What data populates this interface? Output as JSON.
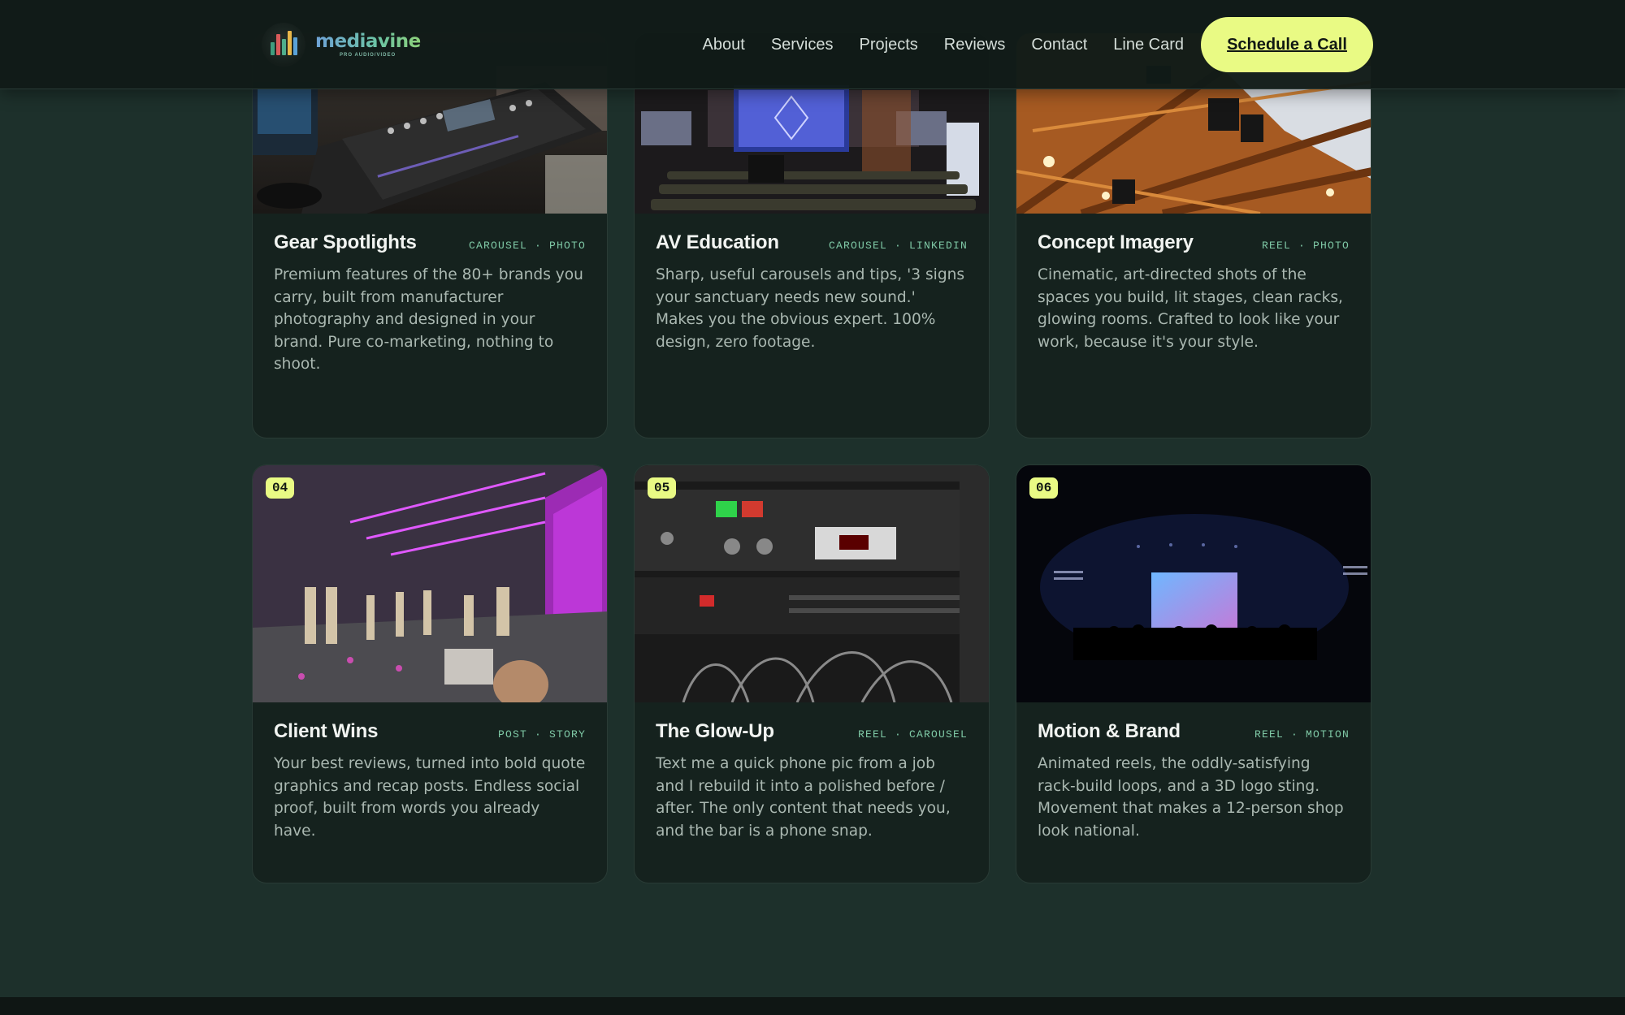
{
  "header": {
    "logo": {
      "name": "mediavine",
      "subtitle": "PRO AUDIO/VIDEO"
    },
    "nav": [
      "About",
      "Services",
      "Projects",
      "Reviews",
      "Contact",
      "Line Card"
    ],
    "cta_label": "Schedule a Call"
  },
  "cards": [
    {
      "title": "Gear Spotlights",
      "tags": "CAROUSEL · PHOTO",
      "desc": "Premium features of the 80+ brands you carry, built from manufacturer photography and designed in your brand. Pure co-marketing, nothing to shoot."
    },
    {
      "title": "AV Education",
      "tags": "CAROUSEL · LINKEDIN",
      "desc": "Sharp, useful carousels and tips, '3 signs your sanctuary needs new sound.' Makes you the obvious expert. 100% design, zero footage."
    },
    {
      "title": "Concept Imagery",
      "tags": "REEL · PHOTO",
      "desc": "Cinematic, art-directed shots of the spaces you build, lit stages, clean racks, glowing rooms. Crafted to look like your work, because it's your style."
    },
    {
      "badge": "04",
      "title": "Client Wins",
      "tags": "POST · STORY",
      "desc": "Your best reviews, turned into bold quote graphics and recap posts. Endless social proof, built from words you already have."
    },
    {
      "badge": "05",
      "title": "The Glow-Up",
      "tags": "REEL · CAROUSEL",
      "desc": "Text me a quick phone pic from a job and I rebuild it into a polished before / after. The only content that needs you, and the bar is a phone snap."
    },
    {
      "badge": "06",
      "title": "Motion & Brand",
      "tags": "REEL · MOTION",
      "desc": "Animated reels, the oddly-satisfying rack-build loops, and a 3D logo sting. Movement that makes a 12-person shop look national."
    }
  ],
  "colors": {
    "accent": "#e9fa84",
    "page_bg": "#1d302b",
    "card_bg": "#15221e",
    "tag": "#7fc9a6"
  }
}
